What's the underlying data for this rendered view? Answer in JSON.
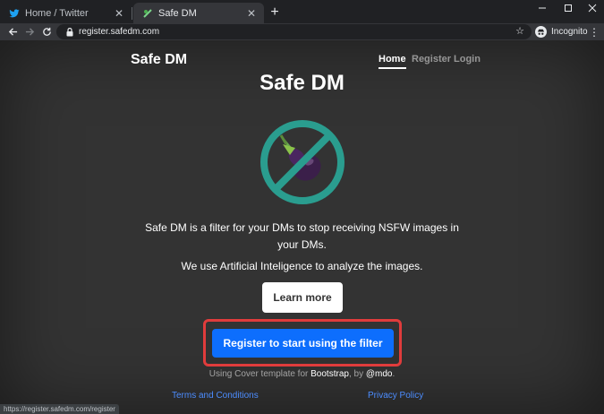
{
  "browser": {
    "tabs": [
      {
        "title": "Home / Twitter",
        "favicon": "twitter-bird-icon",
        "active": false
      },
      {
        "title": "Safe DM",
        "favicon": "safedm-icon",
        "active": true
      }
    ],
    "new_tab_label": "+",
    "url": "register.safedm.com",
    "incognito_label": "Incognito",
    "status_url": "https://register.safedm.com/register"
  },
  "site": {
    "brand": "Safe DM",
    "nav": {
      "home": "Home",
      "register": "Register",
      "login": "Login"
    },
    "heading": "Safe DM",
    "logo": "no-eggplant-icon",
    "lead_line1": "Safe DM is a filter for your DMs to stop receiving NSFW images in your DMs.",
    "lead_line2": "We use Artificial Inteligence to analyze the images.",
    "learn_more": "Learn more",
    "register_cta": "Register to start using the filter",
    "credit": {
      "prefix": "Using Cover template for ",
      "bootstrap": "Bootstrap",
      "by": ", by ",
      "author": "@mdo",
      "suffix": "."
    },
    "footer": {
      "terms": "Terms and Conditions",
      "privacy": "Privacy Policy"
    }
  },
  "colors": {
    "accent": "#0d6efd",
    "highlight": "#e03c3c",
    "link": "#4c8dff",
    "page_bg": "#333333",
    "no_sign": "#2a9d8f"
  }
}
